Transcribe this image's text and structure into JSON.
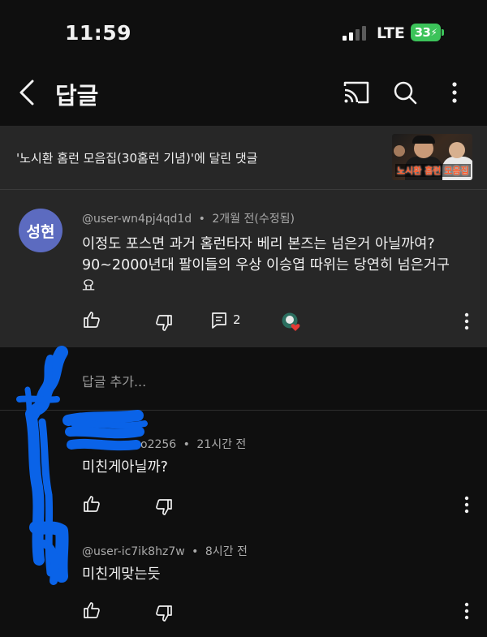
{
  "status_bar": {
    "time": "11:59",
    "network": "LTE",
    "battery": "33"
  },
  "header": {
    "title": "답글",
    "icons": [
      "back-icon",
      "cast-icon",
      "search-icon",
      "more-icon"
    ]
  },
  "video": {
    "label": "'노시환 홈런 모음집(30홈런 기념)'에 달린 댓글",
    "thumbnail_text": "노시환 홈런 모음집"
  },
  "comment": {
    "avatar_text": "성현",
    "author": "@user-wn4pj4qd1d",
    "time": "2개월 전(수정됨)",
    "text": "이정도 포스면 과거 홈런타자 베리 본즈는 넘은거 아닐까여?\n90~2000년대 팔이들의 우상 이승엽 따위는 당연히 넘은거구\n요",
    "lines": [
      "이정도 포스면 과거 홈런타자 베리 본즈는 넘은거 아닐까여?",
      "90~2000년대 팔이들의 우상 이승엽 따위는 당연히 넘은거구",
      "요"
    ],
    "reply_count": "2",
    "colors": {
      "avatar_bg": "#5c6bc0",
      "panel_bg": "#272727"
    }
  },
  "add_reply": {
    "placeholder": "답글 추가..."
  },
  "replies": [
    {
      "author": "o2256",
      "time": "21시간 전",
      "text": "미친게아닐까?"
    },
    {
      "author": "@user-ic7ik8hz7w",
      "time": "8시간 전",
      "text": "미친게맞는듯"
    }
  ],
  "separator": "•",
  "accent": {
    "scribble": "#0a63e8"
  }
}
